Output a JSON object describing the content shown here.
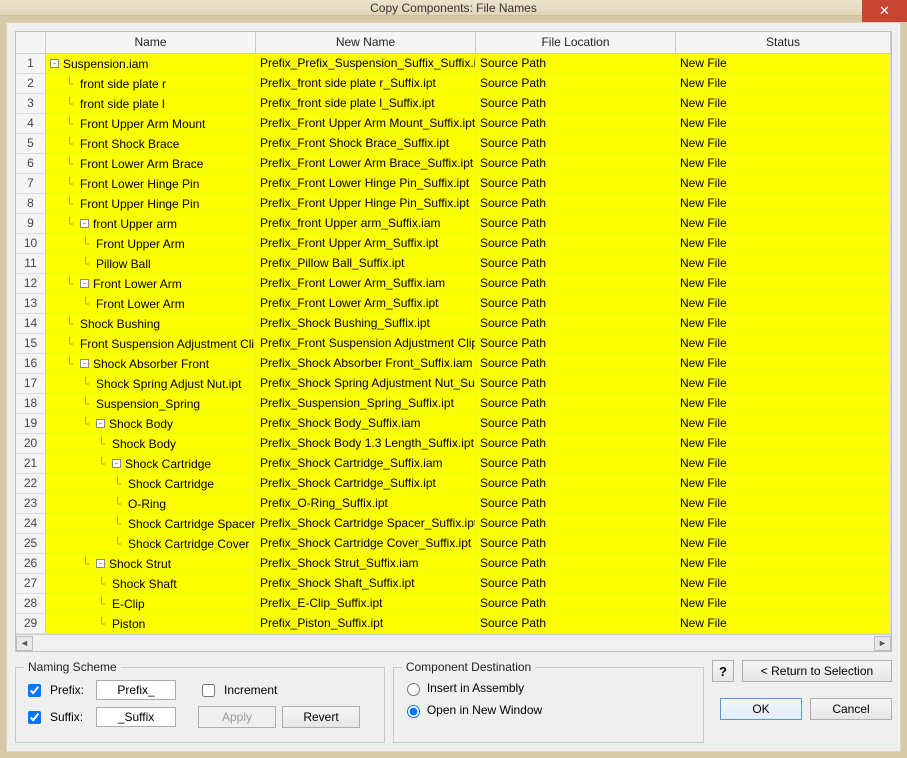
{
  "window_title": "Copy Components: File Names",
  "headers": {
    "name": "Name",
    "new": "New Name",
    "loc": "File Location",
    "stat": "Status"
  },
  "rows": [
    {
      "n": 1,
      "indent": 0,
      "toggle": "-",
      "name": "Suspension.iam",
      "new": "Prefix_Prefix_Suspension_Suffix_Suffix.iam",
      "loc": "Source Path",
      "stat": "New File"
    },
    {
      "n": 2,
      "indent": 1,
      "name": "front side plate r",
      "new": "Prefix_front side plate r_Suffix.ipt",
      "loc": "Source Path",
      "stat": "New File"
    },
    {
      "n": 3,
      "indent": 1,
      "name": "front side plate l",
      "new": "Prefix_front side plate l_Suffix.ipt",
      "loc": "Source Path",
      "stat": "New File"
    },
    {
      "n": 4,
      "indent": 1,
      "name": "Front Upper Arm Mount",
      "new": "Prefix_Front Upper Arm Mount_Suffix.ipt",
      "loc": "Source Path",
      "stat": "New File"
    },
    {
      "n": 5,
      "indent": 1,
      "name": "Front Shock Brace",
      "new": "Prefix_Front Shock Brace_Suffix.ipt",
      "loc": "Source Path",
      "stat": "New File"
    },
    {
      "n": 6,
      "indent": 1,
      "name": "Front Lower Arm Brace",
      "new": "Prefix_Front Lower Arm Brace_Suffix.ipt",
      "loc": "Source Path",
      "stat": "New File"
    },
    {
      "n": 7,
      "indent": 1,
      "name": "Front Lower Hinge Pin",
      "new": "Prefix_Front Lower Hinge Pin_Suffix.ipt",
      "loc": "Source Path",
      "stat": "New File"
    },
    {
      "n": 8,
      "indent": 1,
      "name": "Front Upper Hinge Pin",
      "new": "Prefix_Front Upper Hinge Pin_Suffix.ipt",
      "loc": "Source Path",
      "stat": "New File"
    },
    {
      "n": 9,
      "indent": 1,
      "toggle": "-",
      "name": "front Upper arm",
      "new": "Prefix_front Upper arm_Suffix.iam",
      "loc": "Source Path",
      "stat": "New File"
    },
    {
      "n": 10,
      "indent": 2,
      "name": "Front Upper Arm",
      "new": "Prefix_Front Upper Arm_Suffix.ipt",
      "loc": "Source Path",
      "stat": "New File"
    },
    {
      "n": 11,
      "indent": 2,
      "name": "Pillow Ball",
      "new": "Prefix_Pillow Ball_Suffix.ipt",
      "loc": "Source Path",
      "stat": "New File"
    },
    {
      "n": 12,
      "indent": 1,
      "toggle": "-",
      "name": "Front Lower Arm",
      "new": "Prefix_Front Lower Arm_Suffix.iam",
      "loc": "Source Path",
      "stat": "New File"
    },
    {
      "n": 13,
      "indent": 2,
      "name": "Front Lower Arm",
      "new": "Prefix_Front Lower Arm_Suffix.ipt",
      "loc": "Source Path",
      "stat": "New File"
    },
    {
      "n": 14,
      "indent": 1,
      "name": "Shock Bushing",
      "new": "Prefix_Shock Bushing_Suffix.ipt",
      "loc": "Source Path",
      "stat": "New File"
    },
    {
      "n": 15,
      "indent": 1,
      "name": "Front Suspension Adjustment Clip",
      "new": "Prefix_Front Suspension Adjustment Clip_Suf",
      "loc": "Source Path",
      "stat": "New File"
    },
    {
      "n": 16,
      "indent": 1,
      "toggle": "-",
      "name": "Shock Absorber Front",
      "new": "Prefix_Shock Absorber Front_Suffix.iam",
      "loc": "Source Path",
      "stat": "New File"
    },
    {
      "n": 17,
      "indent": 2,
      "name": "Shock Spring Adjust Nut.ipt",
      "new": "Prefix_Shock Spring Adjustment Nut_Suffix.ip",
      "loc": "Source Path",
      "stat": "New File"
    },
    {
      "n": 18,
      "indent": 2,
      "name": "Suspension_Spring",
      "new": "Prefix_Suspension_Spring_Suffix.ipt",
      "loc": "Source Path",
      "stat": "New File"
    },
    {
      "n": 19,
      "indent": 2,
      "toggle": "-",
      "name": "Shock Body",
      "new": "Prefix_Shock Body_Suffix.iam",
      "loc": "Source Path",
      "stat": "New File"
    },
    {
      "n": 20,
      "indent": 3,
      "name": "Shock Body",
      "new": "Prefix_Shock Body 1.3 Length_Suffix.ipt",
      "loc": "Source Path",
      "stat": "New File"
    },
    {
      "n": 21,
      "indent": 3,
      "toggle": "-",
      "name": "Shock Cartridge",
      "new": "Prefix_Shock Cartridge_Suffix.iam",
      "loc": "Source Path",
      "stat": "New File"
    },
    {
      "n": 22,
      "indent": 4,
      "name": "Shock Cartridge",
      "new": "Prefix_Shock Cartridge_Suffix.ipt",
      "loc": "Source Path",
      "stat": "New File"
    },
    {
      "n": 23,
      "indent": 4,
      "name": "O-Ring",
      "new": "Prefix_O-Ring_Suffix.ipt",
      "loc": "Source Path",
      "stat": "New File"
    },
    {
      "n": 24,
      "indent": 4,
      "name": "Shock Cartridge Spacer",
      "new": "Prefix_Shock Cartridge Spacer_Suffix.ipt",
      "loc": "Source Path",
      "stat": "New File"
    },
    {
      "n": 25,
      "indent": 4,
      "name": "Shock Cartridge Cover",
      "new": "Prefix_Shock Cartridge Cover_Suffix.ipt",
      "loc": "Source Path",
      "stat": "New File"
    },
    {
      "n": 26,
      "indent": 2,
      "toggle": "-",
      "name": "Shock Strut",
      "new": "Prefix_Shock Strut_Suffix.iam",
      "loc": "Source Path",
      "stat": "New File"
    },
    {
      "n": 27,
      "indent": 3,
      "name": "Shock Shaft",
      "new": "Prefix_Shock Shaft_Suffix.ipt",
      "loc": "Source Path",
      "stat": "New File"
    },
    {
      "n": 28,
      "indent": 3,
      "name": "E-Clip",
      "new": "Prefix_E-Clip_Suffix.ipt",
      "loc": "Source Path",
      "stat": "New File"
    },
    {
      "n": 29,
      "indent": 3,
      "name": "Piston",
      "new": "Prefix_Piston_Suffix.ipt",
      "loc": "Source Path",
      "stat": "New File"
    }
  ],
  "naming_scheme": {
    "legend": "Naming Scheme",
    "prefix_label": "Prefix:",
    "prefix_value": "Prefix_",
    "suffix_label": "Suffix:",
    "suffix_value": "_Suffix",
    "increment_label": "Increment",
    "apply_label": "Apply",
    "revert_label": "Revert",
    "prefix_checked": true,
    "suffix_checked": true,
    "increment_checked": false
  },
  "component_destination": {
    "legend": "Component Destination",
    "insert_label": "Insert in Assembly",
    "open_label": "Open in New Window",
    "selected": "open"
  },
  "buttons": {
    "help": "?",
    "return": "< Return to Selection",
    "ok": "OK",
    "cancel": "Cancel"
  }
}
